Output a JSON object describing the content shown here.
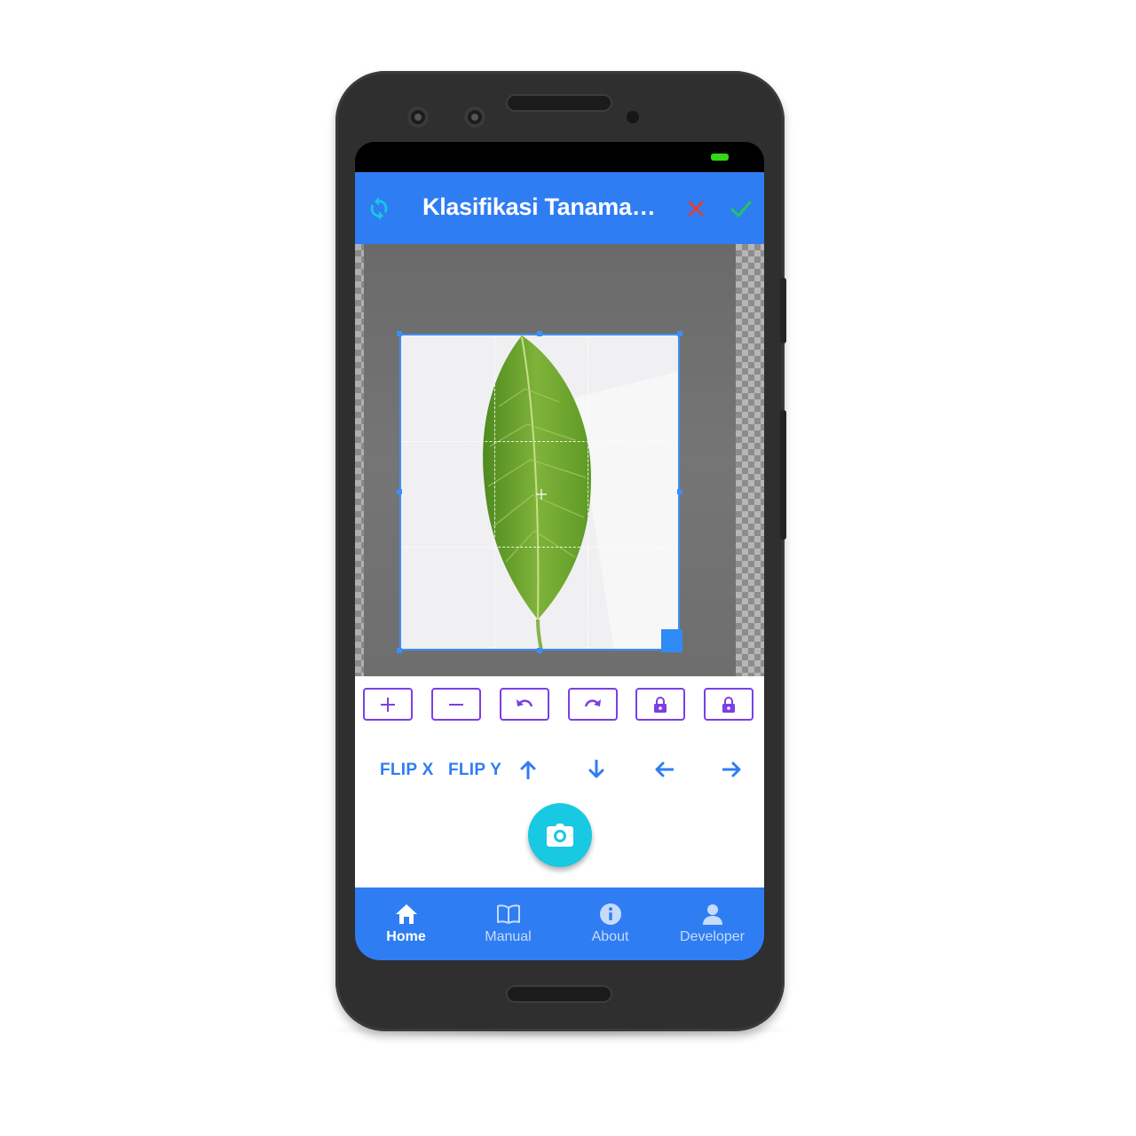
{
  "appbar": {
    "title": "Klasifikasi Tanaman Herbal",
    "refresh_icon": "refresh-icon",
    "cancel_icon": "close-icon",
    "confirm_icon": "check-icon",
    "colors": {
      "background": "#2f7df2",
      "refresh": "#19c8e1",
      "cancel": "#d9423b",
      "confirm": "#22c55e"
    }
  },
  "crop_toolbar": {
    "buttons": [
      {
        "icon": "zoom-in-plus-icon"
      },
      {
        "icon": "zoom-out-minus-icon"
      },
      {
        "icon": "rotate-left-icon"
      },
      {
        "icon": "rotate-right-icon"
      },
      {
        "icon": "lock-aspect-icon"
      },
      {
        "icon": "lock-icon"
      }
    ],
    "border_color": "#7b3fe4"
  },
  "transform": {
    "flip_x": "FLIP X",
    "flip_y": "FLIP Y",
    "arrows": [
      "arrow-up-icon",
      "arrow-down-icon",
      "arrow-left-icon",
      "arrow-right-icon"
    ]
  },
  "camera_button": {
    "icon": "camera-icon",
    "color": "#19c8e1"
  },
  "bottom_nav": {
    "items": [
      {
        "label": "Home",
        "icon": "home-icon",
        "active": true
      },
      {
        "label": "Manual",
        "icon": "book-icon",
        "active": false
      },
      {
        "label": "About",
        "icon": "info-icon",
        "active": false
      },
      {
        "label": "Developer",
        "icon": "person-icon",
        "active": false
      }
    ]
  }
}
